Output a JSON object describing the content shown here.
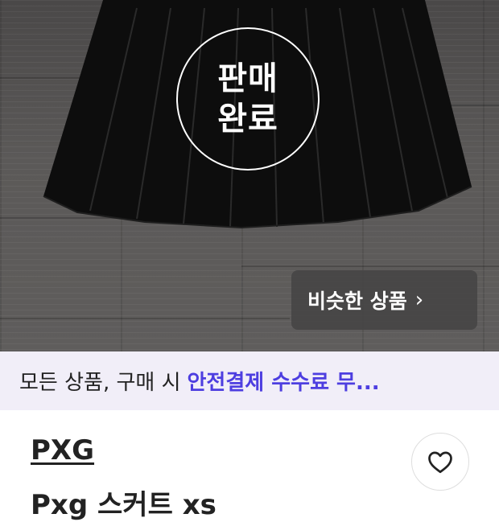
{
  "product_image": {
    "sold_badge": {
      "line1": "판매",
      "line2": "완료"
    },
    "similar_button": {
      "label": "비슷한 상품",
      "chevron": "›",
      "icon": "chevron-right-icon"
    }
  },
  "promo_banner": {
    "prefix": "모든 상품, 구매 시",
    "highlight": "안전결제 수수료 무..."
  },
  "product": {
    "brand": "PXG",
    "title": "Pxg 스커트 xs",
    "like_icon": "heart-outline-icon"
  },
  "colors": {
    "accent": "#4d3ee0",
    "banner_bg": "#f1eef8",
    "text": "#222222"
  }
}
